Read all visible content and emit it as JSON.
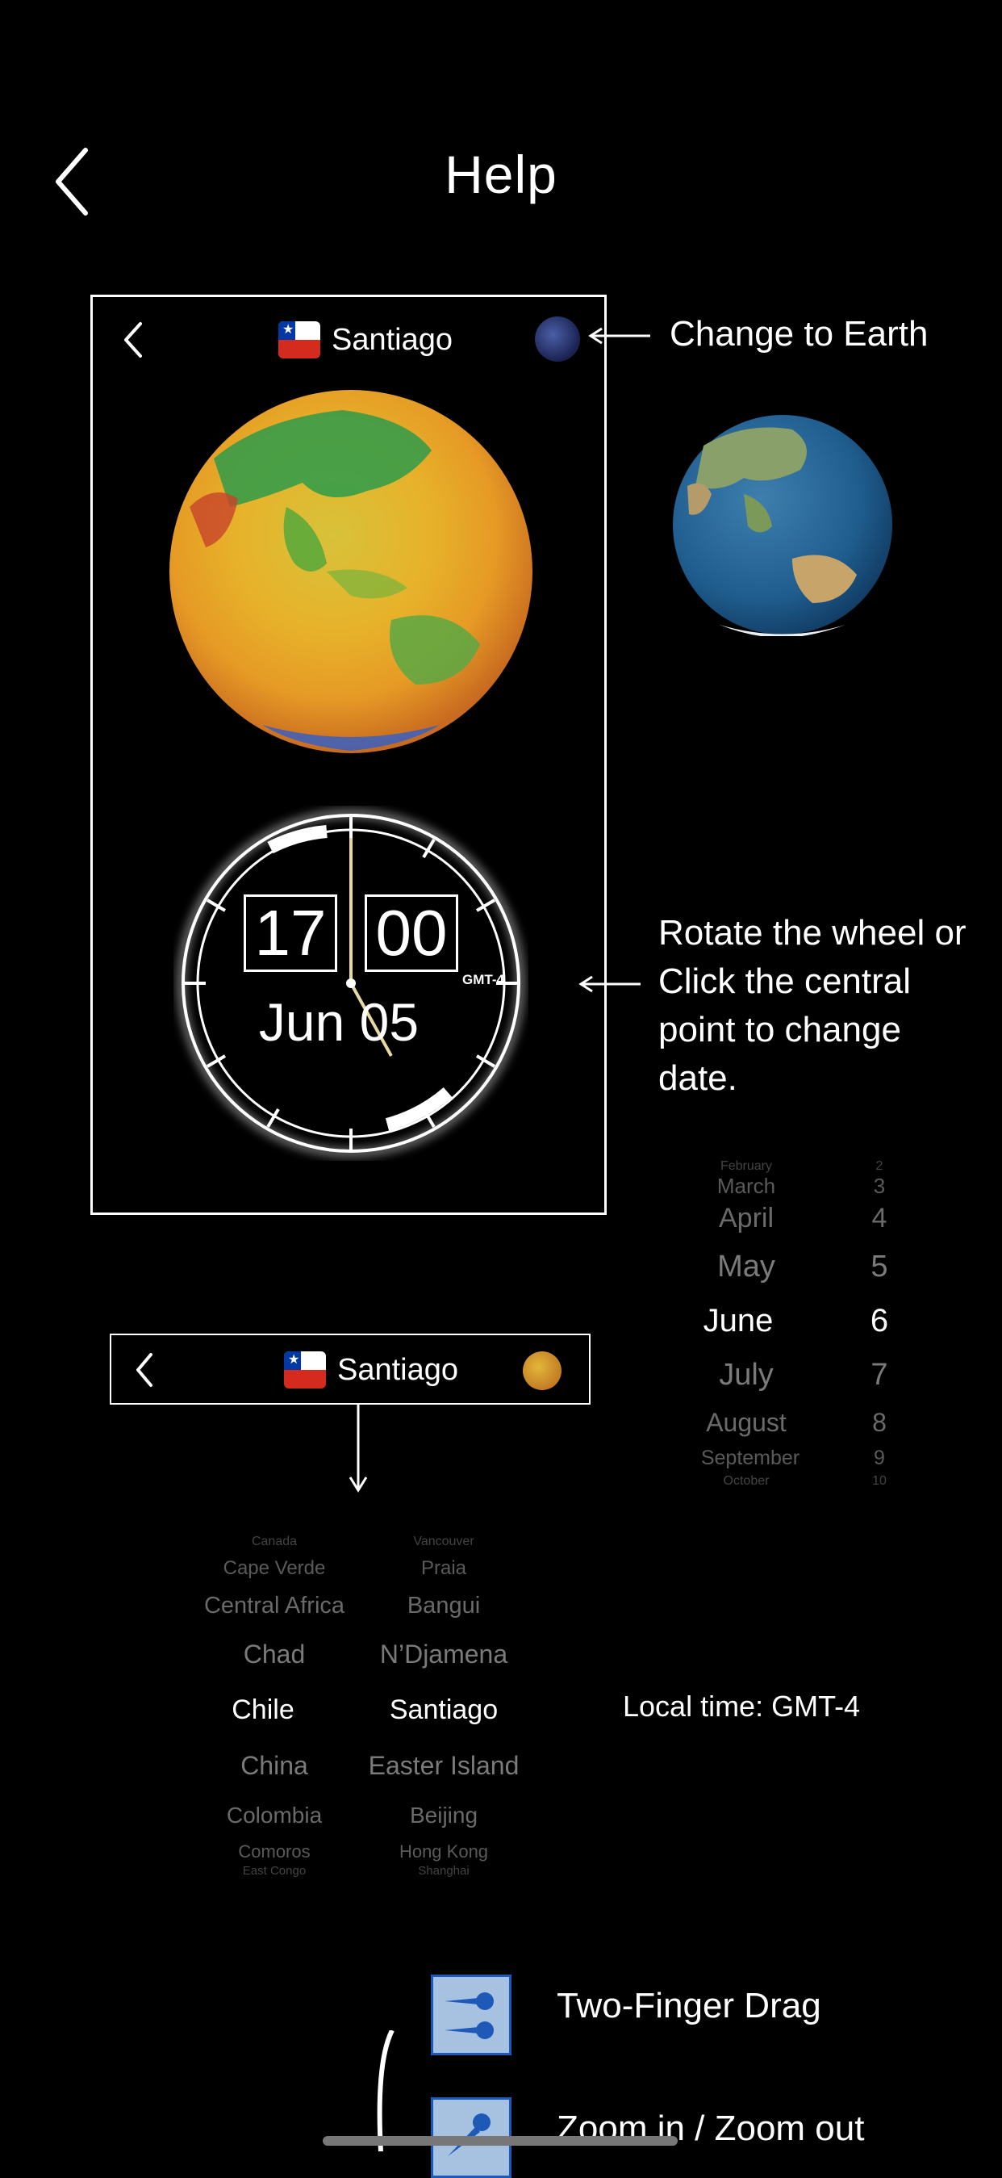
{
  "header": {
    "title": "Help",
    "back_icon": "chevron-left-icon"
  },
  "preview": {
    "city": "Santiago",
    "flag_icon": "chile-flag-icon",
    "toggle_icon": "earth-globe-icon",
    "clock": {
      "hours": "17",
      "minutes": "00",
      "date": "Jun 05",
      "timezone": "GMT-4"
    }
  },
  "annotations": {
    "change_to_earth": "Change to Earth",
    "rotate_wheel": [
      "Rotate the wheel or",
      "Click the central",
      "point to change",
      "date."
    ],
    "local_time": "Local time: GMT-4"
  },
  "month_picker": {
    "rows": [
      {
        "month": "February",
        "num": "2"
      },
      {
        "month": "March",
        "num": "3"
      },
      {
        "month": "April",
        "num": "4"
      },
      {
        "month": "May",
        "num": "5"
      },
      {
        "month": "June",
        "num": "6"
      },
      {
        "month": "July",
        "num": "7"
      },
      {
        "month": "August",
        "num": "8"
      },
      {
        "month": "September",
        "num": "9"
      },
      {
        "month": "October",
        "num": "10"
      }
    ]
  },
  "search_bar": {
    "city": "Santiago"
  },
  "country_picker": {
    "rows": [
      {
        "country": "Canada",
        "city": "Vancouver"
      },
      {
        "country": "Cape Verde",
        "city": "Praia"
      },
      {
        "country": "Central Africa",
        "city": "Bangui"
      },
      {
        "country": "Chad",
        "city": "N’Djamena"
      },
      {
        "country": "Chile",
        "city": "Santiago"
      },
      {
        "country": "China",
        "city": "Easter Island"
      },
      {
        "country": "Colombia",
        "city": "Beijing"
      },
      {
        "country": "Comoros",
        "city": "Hong Kong"
      },
      {
        "country": "East Congo",
        "city": "Shanghai"
      }
    ]
  },
  "gestures": [
    {
      "label": "Two-Finger Drag",
      "icon": "two-finger-drag-icon"
    },
    {
      "label": "Zoom in / Zoom out",
      "icon": "pinch-zoom-icon"
    }
  ],
  "colors": {
    "background": "#000000",
    "text": "#ffffff",
    "gesture_icon_bg": "#a7c2e0",
    "gesture_icon_border": "#1f59b8"
  }
}
